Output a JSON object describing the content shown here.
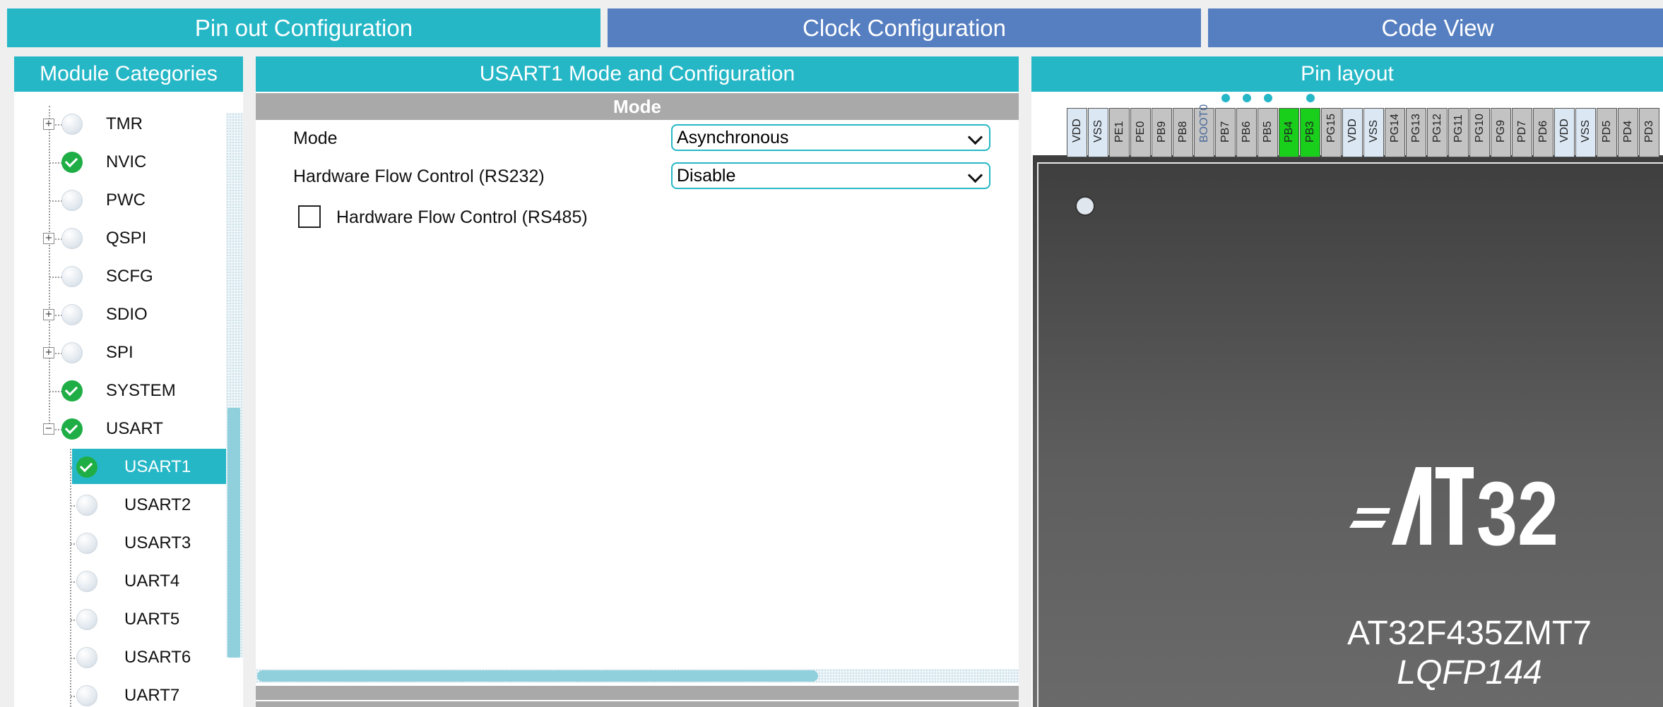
{
  "tabs": [
    {
      "label": "Pin out  Configuration",
      "active": true
    },
    {
      "label": "Clock Configuration",
      "active": false
    },
    {
      "label": "Code View",
      "active": false
    }
  ],
  "colors": {
    "accent": "#26b7c7",
    "tab_inactive": "#567fc1",
    "enabled": "#1fae46",
    "pin_assigned": "#19cf1b"
  },
  "module_panel": {
    "title": "Module Categories",
    "items": [
      {
        "label": "TMR",
        "status": "off",
        "expander": "+"
      },
      {
        "label": "NVIC",
        "status": "on",
        "expander": ""
      },
      {
        "label": "PWC",
        "status": "off",
        "expander": ""
      },
      {
        "label": "QSPI",
        "status": "off",
        "expander": "+"
      },
      {
        "label": "SCFG",
        "status": "off",
        "expander": ""
      },
      {
        "label": "SDIO",
        "status": "off",
        "expander": "+"
      },
      {
        "label": "SPI",
        "status": "off",
        "expander": "+"
      },
      {
        "label": "SYSTEM",
        "status": "on",
        "expander": ""
      },
      {
        "label": "USART",
        "status": "on",
        "expander": "−"
      }
    ],
    "children": [
      {
        "label": "USART1",
        "status": "on",
        "selected": true
      },
      {
        "label": "USART2",
        "status": "off",
        "selected": false
      },
      {
        "label": "USART3",
        "status": "off",
        "selected": false
      },
      {
        "label": "UART4",
        "status": "off",
        "selected": false
      },
      {
        "label": "UART5",
        "status": "off",
        "selected": false
      },
      {
        "label": "USART6",
        "status": "off",
        "selected": false
      },
      {
        "label": "UART7",
        "status": "off",
        "selected": false
      }
    ]
  },
  "config_panel": {
    "title": "USART1 Mode and Configuration",
    "section": "Mode",
    "mode_label": "Mode",
    "mode_value": "Asynchronous",
    "hfc232_label": "Hardware Flow Control (RS232)",
    "hfc232_value": "Disable",
    "hfc485_label": "Hardware Flow Control (RS485)",
    "hfc485_checked": false
  },
  "pin_panel": {
    "title": "Pin layout",
    "pins": [
      {
        "name": "VDD",
        "kind": "power"
      },
      {
        "name": "VSS",
        "kind": "power"
      },
      {
        "name": "PE1",
        "kind": "io"
      },
      {
        "name": "PE0",
        "kind": "io"
      },
      {
        "name": "PB9",
        "kind": "io"
      },
      {
        "name": "PB8",
        "kind": "io"
      },
      {
        "name": "BOOT0",
        "kind": "boot"
      },
      {
        "name": "PB7",
        "kind": "io"
      },
      {
        "name": "PB6",
        "kind": "io"
      },
      {
        "name": "PB5",
        "kind": "io"
      },
      {
        "name": "PB4",
        "kind": "assigned"
      },
      {
        "name": "PB3",
        "kind": "assigned"
      },
      {
        "name": "PG15",
        "kind": "io"
      },
      {
        "name": "VDD",
        "kind": "power"
      },
      {
        "name": "VSS",
        "kind": "power"
      },
      {
        "name": "PG14",
        "kind": "io"
      },
      {
        "name": "PG13",
        "kind": "io"
      },
      {
        "name": "PG12",
        "kind": "io"
      },
      {
        "name": "PG11",
        "kind": "io"
      },
      {
        "name": "PG10",
        "kind": "io"
      },
      {
        "name": "PG9",
        "kind": "io"
      },
      {
        "name": "PD7",
        "kind": "io"
      },
      {
        "name": "PD6",
        "kind": "io"
      },
      {
        "name": "VDD",
        "kind": "power"
      },
      {
        "name": "VSS",
        "kind": "power"
      },
      {
        "name": "PD5",
        "kind": "io"
      },
      {
        "name": "PD4",
        "kind": "io"
      },
      {
        "name": "PD3",
        "kind": "io"
      }
    ],
    "chip": {
      "logo": "AT32",
      "part_number": "AT32F435ZMT7",
      "package": "LQFP144"
    }
  }
}
